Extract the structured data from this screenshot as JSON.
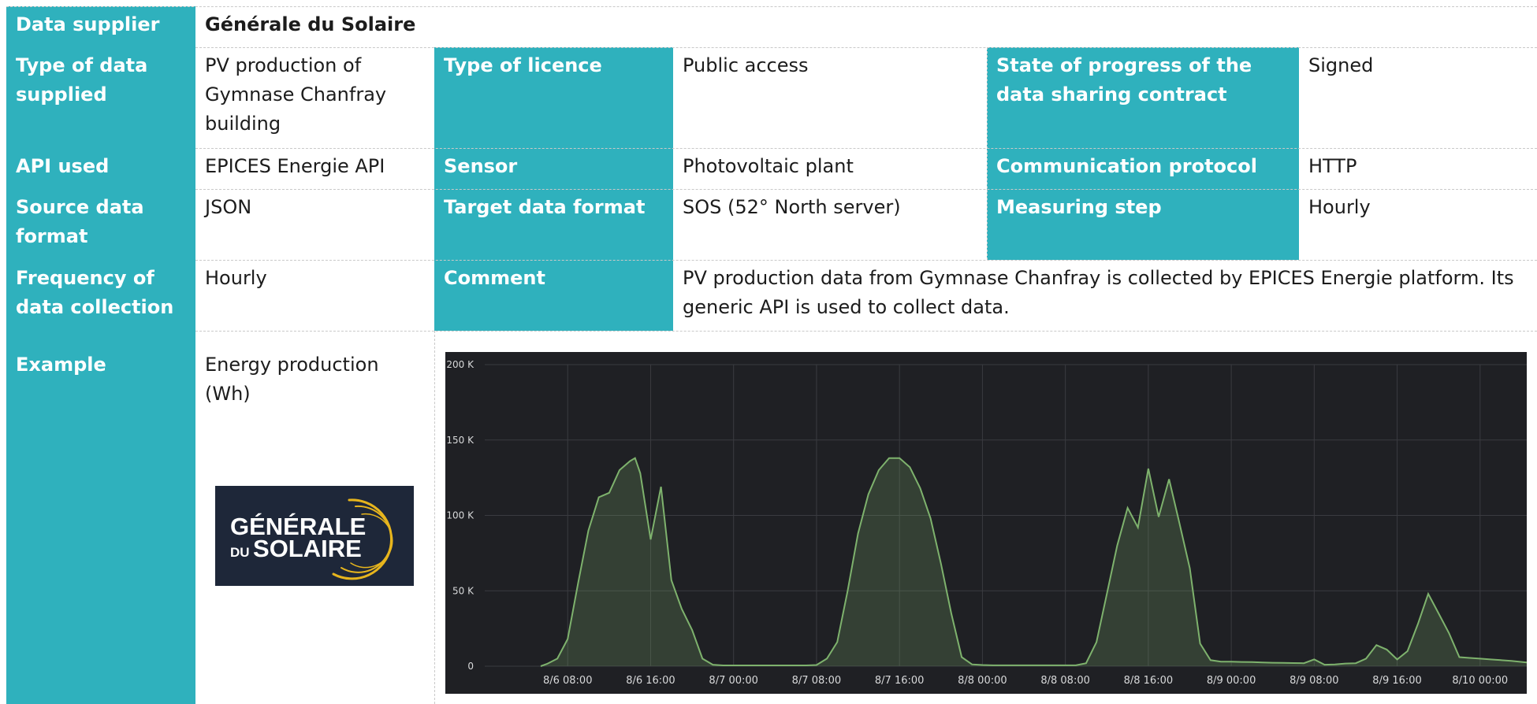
{
  "table": {
    "row1": {
      "supplier_label": "Data supplier",
      "supplier_value": "Générale du Solaire"
    },
    "row2": {
      "type_label": "Type of data supplied",
      "type_value": "PV production of Gymnase Chanfray building",
      "licence_label": "Type of licence",
      "licence_value": "Public access",
      "contract_label": "State of progress of the data sharing contract",
      "contract_value": "Signed"
    },
    "row3": {
      "api_label": "API used",
      "api_value": "EPICES Energie API",
      "sensor_label": "Sensor",
      "sensor_value": "Photovoltaic plant",
      "protocol_label": "Communication protocol",
      "protocol_value": "HTTP"
    },
    "row4": {
      "source_label": "Source data format",
      "source_value": "JSON",
      "target_label": "Target data format",
      "target_value": "SOS (52° North server)",
      "step_label": "Measuring step",
      "step_value": "Hourly"
    },
    "row5": {
      "freq_label": "Frequency of data collection",
      "freq_value": "Hourly",
      "comment_label": "Comment",
      "comment_value": "PV production data from Gymnase Chanfray is collected by EPICES Energie platform. Its generic API is used to collect data."
    },
    "row6": {
      "example_label": "Example",
      "example_value": "Energy production (Wh)"
    }
  },
  "logo": {
    "line1": "GÉNÉRALE",
    "line2_small": "DU",
    "line2": "SOLAIRE",
    "ring_color": "#e7b51d"
  },
  "colors": {
    "header": "#2fb1bd",
    "chart_bg": "#1f2024",
    "series": "#7eb26d"
  },
  "chart_data": {
    "type": "area",
    "title": "",
    "xlabel": "",
    "ylabel": "",
    "ylim": [
      0,
      200000
    ],
    "y_ticks": [
      "0",
      "50 K",
      "100 K",
      "150 K",
      "200 K"
    ],
    "y_tick_values": [
      0,
      50000,
      100000,
      150000,
      200000
    ],
    "x_ticks": [
      "8/6 08:00",
      "8/6 16:00",
      "8/7 00:00",
      "8/7 08:00",
      "8/7 16:00",
      "8/8 00:00",
      "8/8 08:00",
      "8/8 16:00",
      "8/9 00:00",
      "8/9 08:00",
      "8/9 16:00",
      "8/10 00:00"
    ],
    "x_tick_hours": [
      8,
      16,
      24,
      32,
      40,
      48,
      56,
      64,
      72,
      80,
      88,
      96
    ],
    "xlim_hours": [
      0,
      100.5
    ],
    "grid": true,
    "series": [
      {
        "x": [
          5.4,
          6,
          7,
          8,
          9,
          10,
          11,
          12,
          13,
          14,
          14.5,
          15,
          16,
          17,
          18,
          19,
          20,
          21,
          22,
          23,
          24,
          25,
          26,
          27,
          28,
          29,
          30,
          31,
          32,
          33,
          34,
          35,
          36,
          37,
          38,
          39,
          40,
          41,
          42,
          43,
          44,
          45,
          46,
          47,
          48,
          49,
          50,
          51,
          52,
          53,
          54,
          55,
          56,
          57,
          58,
          59,
          60,
          61,
          62,
          63,
          64,
          65,
          66,
          67,
          68,
          69,
          70,
          71,
          72,
          73,
          74,
          75,
          76,
          77,
          78,
          79,
          80,
          81,
          82,
          83,
          84,
          85,
          86,
          87,
          88,
          89,
          90,
          91,
          92,
          93,
          94,
          95,
          96,
          97,
          98,
          99,
          100.5
        ],
        "values": [
          0,
          1500,
          5000,
          18000,
          55000,
          90000,
          112000,
          115000,
          130000,
          136000,
          138000,
          128000,
          84000,
          119000,
          57000,
          38000,
          24000,
          5000,
          1000,
          500,
          500,
          500,
          500,
          500,
          500,
          500,
          500,
          500,
          800,
          5000,
          16000,
          50000,
          88000,
          114000,
          130000,
          138000,
          138000,
          132000,
          118000,
          98000,
          68000,
          35000,
          6000,
          1200,
          800,
          600,
          600,
          600,
          600,
          600,
          600,
          600,
          600,
          600,
          2000,
          16000,
          48000,
          80000,
          105000,
          92000,
          131000,
          99000,
          124000,
          95000,
          65000,
          15000,
          4000,
          3000,
          3000,
          2800,
          2700,
          2500,
          2300,
          2200,
          2100,
          2000,
          4500,
          1000,
          1200,
          1800,
          2000,
          5000,
          14000,
          11000,
          4500,
          10000,
          28000,
          48000,
          35000,
          22000,
          6000,
          5500,
          5000,
          4500,
          4000,
          3500,
          2500
        ]
      }
    ]
  }
}
